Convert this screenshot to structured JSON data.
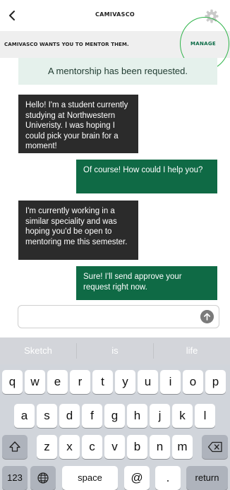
{
  "nav": {
    "title": "CAMIVASCO",
    "back_icon": "chevron-left-icon",
    "settings_icon": "gear-icon"
  },
  "banner": {
    "message": "CAMIVASCO WANTS YOU TO MENTOR THEM.",
    "manage_label": "MANAGE"
  },
  "request_notice": "A mentorship has been requested.",
  "messages": [
    {
      "from": "student",
      "text": "Hello! I'm a student currently studying at Northwestern Univeristy. I was hoping I could pick your brain for a moment!"
    },
    {
      "from": "me",
      "text": "Of course! How could I help you?"
    },
    {
      "from": "student",
      "text": "I'm currently working in a similar speciality and was hoping you'd be open to mentoring me this semester."
    },
    {
      "from": "me",
      "text": "Sure! I'll send approve your request right now."
    }
  ],
  "composer": {
    "value": "",
    "placeholder": "",
    "send_icon": "arrow-up-icon"
  },
  "keyboard": {
    "predictions": [
      "Sketch",
      "is",
      "life"
    ],
    "row1": [
      "q",
      "w",
      "e",
      "r",
      "t",
      "y",
      "u",
      "i",
      "o",
      "p"
    ],
    "row2": [
      "a",
      "s",
      "d",
      "f",
      "g",
      "h",
      "j",
      "k",
      "l"
    ],
    "row3": [
      "z",
      "x",
      "c",
      "v",
      "b",
      "n",
      "m"
    ],
    "numbers_label": "123",
    "space_label": "space",
    "at_label": "@",
    "period_label": ".",
    "return_label": "return"
  },
  "colors": {
    "accent": "#0f6a45",
    "incoming_bubble": "#2b2b2b",
    "annotation_circle": "#2fb44a"
  }
}
